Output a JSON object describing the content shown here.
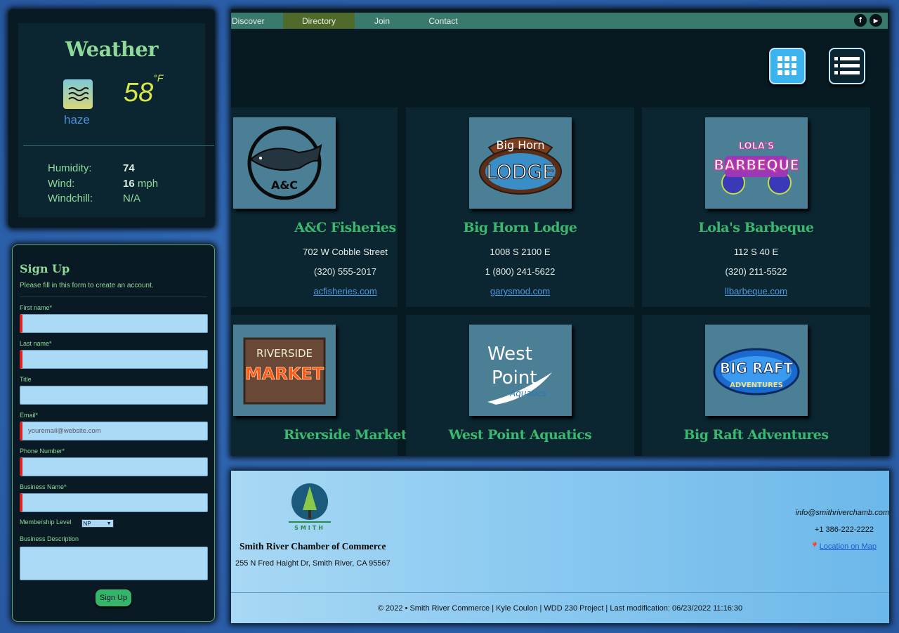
{
  "weather": {
    "title": "Weather",
    "icon": "haze-icon",
    "condition": "haze",
    "temperature": "58",
    "unit": "°F",
    "stats": [
      {
        "label": "Humidity:",
        "value": "74",
        "unit": ""
      },
      {
        "label": "Wind:",
        "value": "16",
        "unit": "mph"
      },
      {
        "label": "Windchill:",
        "value": "N/A",
        "unit": ""
      }
    ]
  },
  "signup": {
    "title": "Sign Up",
    "subtitle": "Please fill in this form to create an account.",
    "fields": [
      {
        "label": "First name*",
        "placeholder": "",
        "required": true
      },
      {
        "label": "Last name*",
        "placeholder": "",
        "required": true
      },
      {
        "label": "Title",
        "placeholder": "",
        "required": false
      },
      {
        "label": "Email*",
        "placeholder": "youremail@website.com",
        "required": true
      },
      {
        "label": "Phone Number*",
        "placeholder": "",
        "required": true
      },
      {
        "label": "Business Name*",
        "placeholder": "",
        "required": true
      }
    ],
    "membership_label": "Membership Level",
    "membership_value": "NP",
    "description_label": "Business Description",
    "button": "Sign Up"
  },
  "nav": {
    "items": [
      "Discover",
      "Directory",
      "Join",
      "Contact"
    ],
    "active": "Directory",
    "social": [
      "facebook-icon",
      "youtube-icon"
    ]
  },
  "directory": {
    "businesses": [
      {
        "name": "A&C Fisheries",
        "address": "702 W Cobble Street",
        "phone": "(320) 555-2017",
        "website": "acfisheries.com",
        "logo": "fish-logo",
        "logo_text": "A&C"
      },
      {
        "name": "Big Horn Lodge",
        "address": "1008 S 2100 E",
        "phone": "1 (800) 241-5622",
        "website": "garysmod.com",
        "logo": "lodge-logo",
        "logo_text": "Big Horn",
        "logo_text2": "LODGE"
      },
      {
        "name": "Lola's Barbeque",
        "address": "112 S 40 E",
        "phone": "(320) 211-5522",
        "website": "llbarbeque.com",
        "logo": "bbq-logo",
        "logo_text": "LOLA'S",
        "logo_text2": "BARBEQUE"
      },
      {
        "name": "Riverside Market",
        "address": "",
        "phone": "",
        "website": "",
        "logo": "market-logo",
        "logo_text": "RIVERSIDE",
        "logo_text2": "MARKET"
      },
      {
        "name": "West Point Aquatics",
        "address": "",
        "phone": "",
        "website": "",
        "logo": "aquatics-logo",
        "logo_text": "West",
        "logo_text2": "Point",
        "logo_text3": "Aquatics"
      },
      {
        "name": "Big Raft Adventures",
        "address": "",
        "phone": "",
        "website": "",
        "logo": "raft-logo",
        "logo_text": "BIG RAFT",
        "logo_text2": "ADVENTURES"
      }
    ]
  },
  "footer": {
    "logo_text": "SMITH",
    "org_name": "Smith River Chamber of Commerce",
    "address": "255 N Fred Haight Dr, Smith River, CA 95567",
    "email": "info@smithriverchamb.com",
    "phone": "+1 386-222-2222",
    "map_link": "Location on Map",
    "copyright": "© 2022 • Smith River Commerce | Kyle Coulon | WDD 230 Project | Last modification: 06/23/2022 11:16:30"
  }
}
